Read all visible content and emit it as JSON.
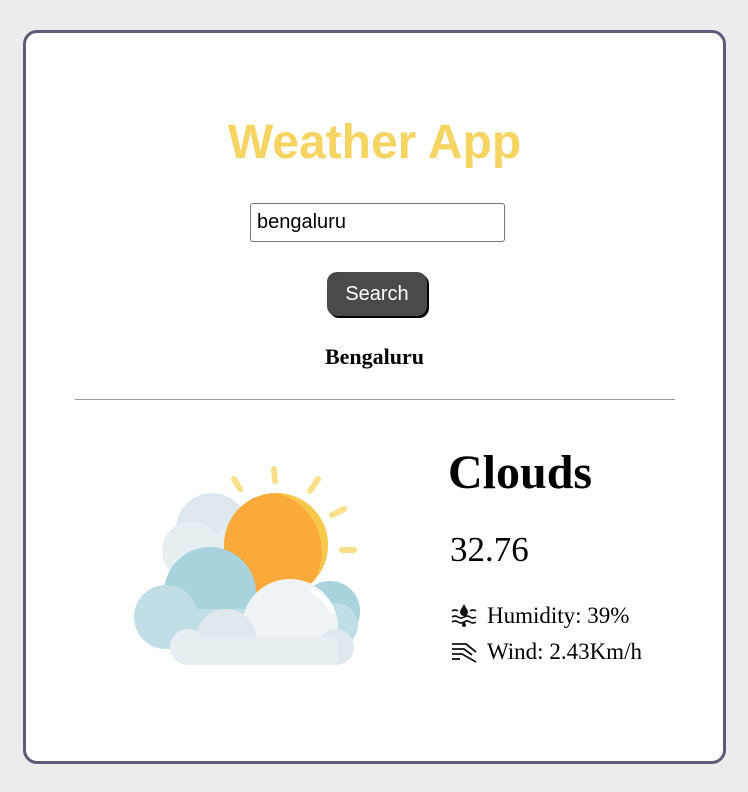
{
  "app": {
    "title": "Weather App",
    "title_color": "#f5d462"
  },
  "search": {
    "value": "bengaluru",
    "button_label": "Search"
  },
  "result": {
    "city": "Bengaluru",
    "condition": "Clouds",
    "temperature": "32.76",
    "humidity": "Humidity: 39%",
    "wind": "Wind: 2.43Km/h",
    "icons": {
      "weather": "sun-behind-clouds-icon",
      "humidity": "humidity-icon",
      "wind": "wind-icon"
    }
  }
}
